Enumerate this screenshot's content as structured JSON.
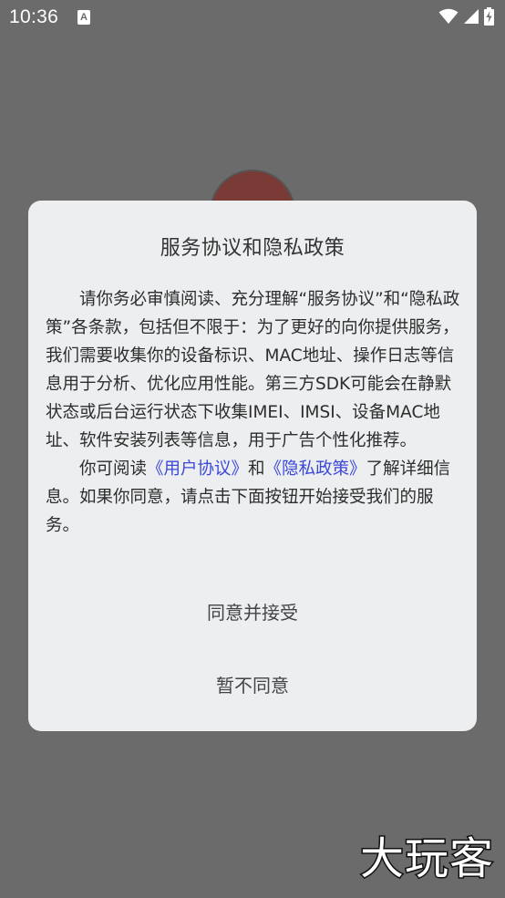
{
  "status_bar": {
    "time": "10:36",
    "notification_icon": "A",
    "icons": [
      "wifi-icon",
      "signal-icon",
      "battery-charging-icon"
    ]
  },
  "dialog": {
    "title": "服务协议和隐私政策",
    "paragraph1": "请你务必审慎阅读、充分理解“服务协议”和“隐私政策”各条款，包括但不限于：为了更好的向你提供服务，我们需要收集你的设备标识、MAC地址、操作日志等信息用于分析、优化应用性能。第三方SDK可能会在静默状态或后台运行状态下收集IMEI、IMSI、设备MAC地址、软件安装列表等信息，用于广告个性化推荐。",
    "p2_prefix": "你可阅读",
    "user_agreement_link": "《用户协议》",
    "p2_and": "和",
    "privacy_policy_link": "《隐私政策》",
    "p2_suffix": "了解详细信息。如果你同意，请点击下面按钮开始接受我们的服务。",
    "accept_label": "同意并接受",
    "decline_label": "暂不同意"
  },
  "watermark": "大玩客",
  "colors": {
    "overlay": "#6b6b6b",
    "dialog_bg": "#eceef0",
    "link": "#3b48d8"
  }
}
